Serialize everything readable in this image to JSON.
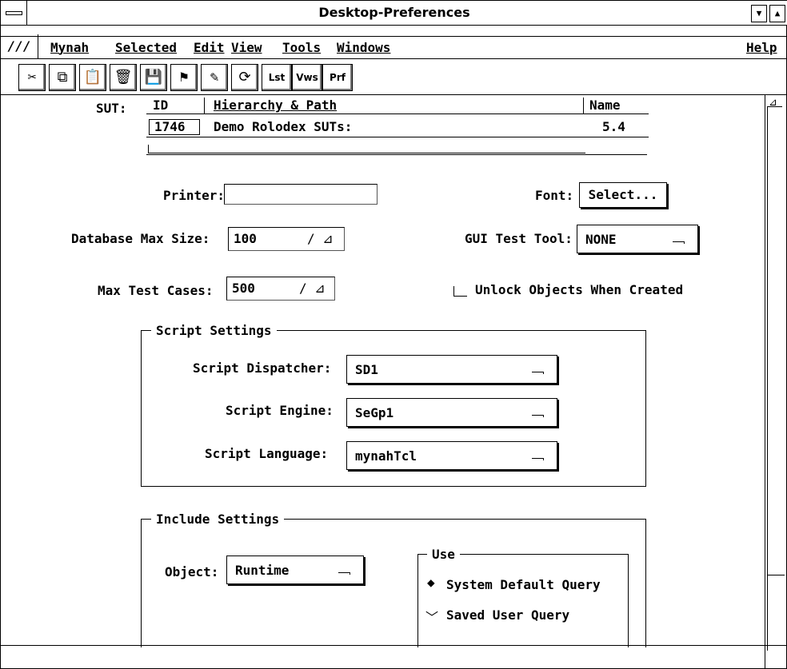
{
  "window": {
    "title": "Desktop-Preferences"
  },
  "menubar": {
    "logo": "///",
    "items": [
      "Mynah",
      "Selected",
      "Edit",
      "View",
      "Tools",
      "Windows"
    ],
    "help": "Help"
  },
  "toolbar": {
    "icons": [
      "scissors-icon",
      "copy-icon",
      "paste-icon",
      "trash-icon",
      "save-icon",
      "runner-icon",
      "brush-icon",
      "refresh-icon"
    ],
    "text_buttons": [
      "Lst",
      "Vws",
      "Prf"
    ]
  },
  "sut": {
    "label": "SUT:",
    "columns": [
      "ID",
      "Hierarchy & Path",
      "Name"
    ],
    "row": {
      "id": "1746",
      "path": "Demo Rolodex SUTs:",
      "name": "5.4"
    }
  },
  "printer": {
    "label": "Printer:",
    "value": ""
  },
  "font": {
    "label": "Font:",
    "button": "Select..."
  },
  "database": {
    "label": "Database Max Size:",
    "value": "100"
  },
  "gui_tool": {
    "label": "GUI Test Tool:",
    "value": "NONE"
  },
  "max_tests": {
    "label": "Max Test Cases:",
    "value": "500"
  },
  "unlock": {
    "label": "Unlock Objects When Created",
    "checked": false
  },
  "script_settings": {
    "title": "Script Settings",
    "dispatcher": {
      "label": "Script Dispatcher:",
      "value": "SD1"
    },
    "engine": {
      "label": "Script Engine:",
      "value": "SeGp1"
    },
    "language": {
      "label": "Script Language:",
      "value": "mynahTcl"
    }
  },
  "include_settings": {
    "title": "Include Settings",
    "object": {
      "label": "Object:",
      "value": "Runtime"
    },
    "use": {
      "title": "Use",
      "options": [
        "System Default Query",
        "Saved User Query"
      ],
      "selected": "System Default Query"
    }
  }
}
